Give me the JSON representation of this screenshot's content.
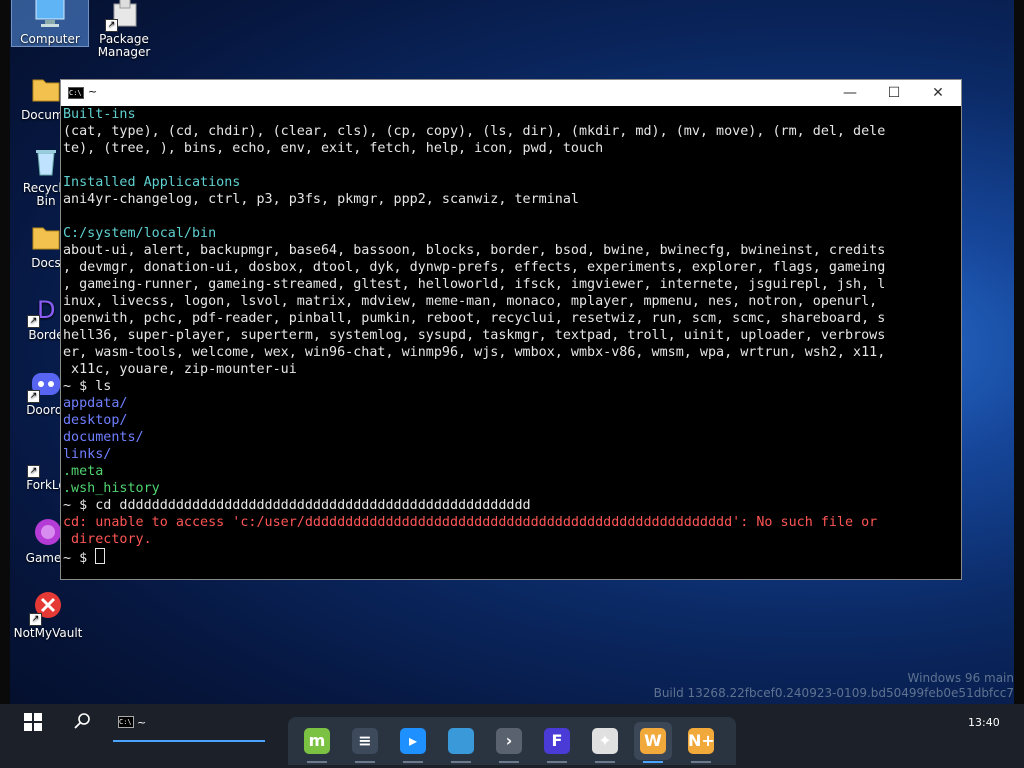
{
  "desktop": {
    "icons": [
      {
        "label": "Computer",
        "icon": "computer-icon"
      },
      {
        "label": "Package\nManager",
        "icon": "package-icon"
      },
      {
        "label": "Docume",
        "icon": "folder-icon"
      },
      {
        "label": "Recycle\nBin",
        "icon": "recycle-bin-icon"
      },
      {
        "label": "Docs",
        "icon": "folder-icon"
      },
      {
        "label": "Borde",
        "icon": "border-app-icon"
      },
      {
        "label": "Doordi",
        "icon": "discord-icon"
      },
      {
        "label": "ForkLo",
        "icon": "shortcut-icon"
      },
      {
        "label": "Gamer",
        "icon": "game-icon"
      },
      {
        "label": "NotMyVault",
        "icon": "error-x-icon"
      }
    ]
  },
  "terminal": {
    "title": "~",
    "lines": [
      {
        "text": "Built-ins",
        "cls": "hdr"
      },
      {
        "text": "(cat, type), (cd, chdir), (clear, cls), (cp, copy), (ls, dir), (mkdir, md), (mv, move), (rm, del, dele",
        "cls": ""
      },
      {
        "text": "te), (tree, ), bins, echo, env, exit, fetch, help, icon, pwd, touch",
        "cls": ""
      },
      {
        "text": "",
        "cls": ""
      },
      {
        "text": "Installed Applications",
        "cls": "hdr"
      },
      {
        "text": "ani4yr-changelog, ctrl, p3, p3fs, pkmgr, ppp2, scanwiz, terminal",
        "cls": ""
      },
      {
        "text": "",
        "cls": ""
      },
      {
        "text": "C:/system/local/bin",
        "cls": "hdr"
      },
      {
        "text": "about-ui, alert, backupmgr, base64, bassoon, blocks, border, bsod, bwine, bwinecfg, bwineinst, credits",
        "cls": ""
      },
      {
        "text": ", devmgr, donation-ui, dosbox, dtool, dyk, dynwp-prefs, effects, experiments, explorer, flags, gameing",
        "cls": ""
      },
      {
        "text": ", gameing-runner, gameing-streamed, gltest, helloworld, ifsck, imgviewer, internete, jsguirepl, jsh, l",
        "cls": ""
      },
      {
        "text": "inux, livecss, logon, lsvol, matrix, mdview, meme-man, monaco, mplayer, mpmenu, nes, notron, openurl,",
        "cls": ""
      },
      {
        "text": "openwith, pchc, pdf-reader, pinball, pumkin, reboot, recyclui, resetwiz, run, scm, scmc, shareboard, s",
        "cls": ""
      },
      {
        "text": "hell36, super-player, superterm, systemlog, sysupd, taskmgr, textpad, troll, uinit, uploader, verbrows",
        "cls": ""
      },
      {
        "text": "er, wasm-tools, welcome, wex, win96-chat, winmp96, wjs, wmbox, wmbx-v86, wmsm, wpa, wrtrun, wsh2, x11,",
        "cls": ""
      },
      {
        "text": " x11c, youare, zip-mounter-ui",
        "cls": ""
      },
      {
        "text": "~ $ ls",
        "cls": ""
      },
      {
        "text": "appdata/",
        "cls": "dir"
      },
      {
        "text": "desktop/",
        "cls": "dir"
      },
      {
        "text": "documents/",
        "cls": "dir"
      },
      {
        "text": "links/",
        "cls": "dir"
      },
      {
        "text": ".meta",
        "cls": "hid"
      },
      {
        "text": ".wsh_history",
        "cls": "hid"
      },
      {
        "text": "~ $ cd ddddddddddddddddddddddddddddddddddddddddddddddddddd",
        "cls": ""
      },
      {
        "text": "cd: unable to access 'c:/user/ddddddddddddddddddddddddddddddddddddddddddddddddddddd': No such file or",
        "cls": "err"
      },
      {
        "text": " directory.",
        "cls": "err"
      }
    ],
    "prompt": "~ $ "
  },
  "watermark": {
    "line1": "Windows 96 main",
    "line2": "Build 13268.22fbcef0.240923-0109.bd50499feb0e51dbfcc7"
  },
  "taskbar": {
    "task_label": "~",
    "clock": "13:40",
    "dock": [
      {
        "name": "linux-mint-icon",
        "glyph": "m",
        "color": "#7cc242"
      },
      {
        "name": "settings-sliders-icon",
        "glyph": "≡",
        "color": "#3d4a5c"
      },
      {
        "name": "store-icon",
        "glyph": "▸",
        "color": "#1e90ff"
      },
      {
        "name": "folder-icon",
        "glyph": "",
        "color": "#3a9ad9"
      },
      {
        "name": "terminal-arrow-icon",
        "glyph": "›",
        "color": "#5a6270"
      },
      {
        "name": "f-app-icon",
        "glyph": "F",
        "color": "#4b3bd6"
      },
      {
        "name": "game-console-icon",
        "glyph": "✦",
        "color": "#e0e0e0"
      },
      {
        "name": "w-app-icon",
        "glyph": "W",
        "color": "#f2a93b"
      },
      {
        "name": "n-plus-icon",
        "glyph": "N+",
        "color": "#f2a93b"
      }
    ]
  }
}
